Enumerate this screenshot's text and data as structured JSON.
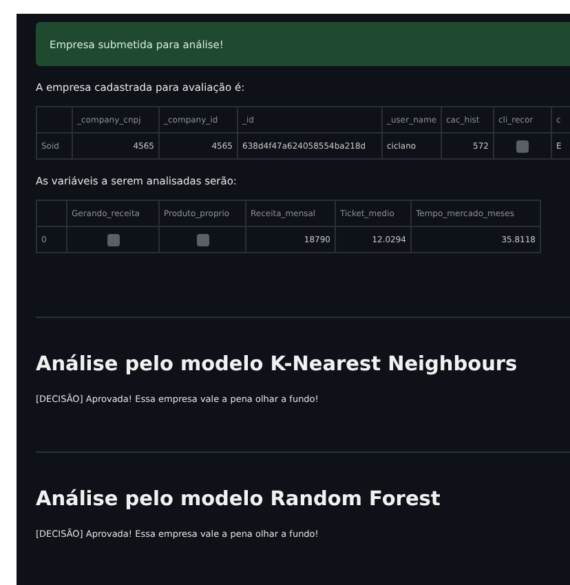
{
  "alert": {
    "kind": "success",
    "text": "Empresa submetida para análise!"
  },
  "company_caption": "A empresa cadastrada para avaliação é:",
  "company_table": {
    "columns": [
      "",
      "_company_cnpj",
      "_company_id",
      "_id",
      "_user_name",
      "cac_hist",
      "cli_recor",
      "c"
    ],
    "rows": [
      [
        {
          "kind": "index",
          "text": "Soid"
        },
        {
          "kind": "number",
          "text": "4565"
        },
        {
          "kind": "number",
          "text": "4565"
        },
        {
          "kind": "text",
          "text": "638d4f47a624058554ba218d"
        },
        {
          "kind": "text",
          "text": "ciclano"
        },
        {
          "kind": "number",
          "text": "572"
        },
        {
          "kind": "check",
          "checked": true
        },
        {
          "kind": "text",
          "text": "E"
        }
      ]
    ]
  },
  "variables_caption": "As variáveis a serem analisadas serão:",
  "variables_table": {
    "columns": [
      "",
      "Gerando_receita",
      "Produto_proprio",
      "Receita_mensal",
      "Ticket_medio",
      "Tempo_mercado_meses"
    ],
    "rows": [
      [
        {
          "kind": "index",
          "text": "0"
        },
        {
          "kind": "check",
          "checked": true
        },
        {
          "kind": "check",
          "checked": true
        },
        {
          "kind": "number",
          "text": "18790"
        },
        {
          "kind": "number",
          "text": "12.0294"
        },
        {
          "kind": "number",
          "text": "35.8118"
        }
      ]
    ]
  },
  "results": [
    {
      "heading": "Análise pelo modelo K-Nearest Neighbours",
      "decision": "[DECISÃO] Aprovada! Essa empresa vale a pena olhar a fundo!"
    },
    {
      "heading": "Análise pelo modelo Random Forest",
      "decision": "[DECISÃO] Aprovada! Essa empresa vale a pena olhar a fundo!"
    }
  ]
}
